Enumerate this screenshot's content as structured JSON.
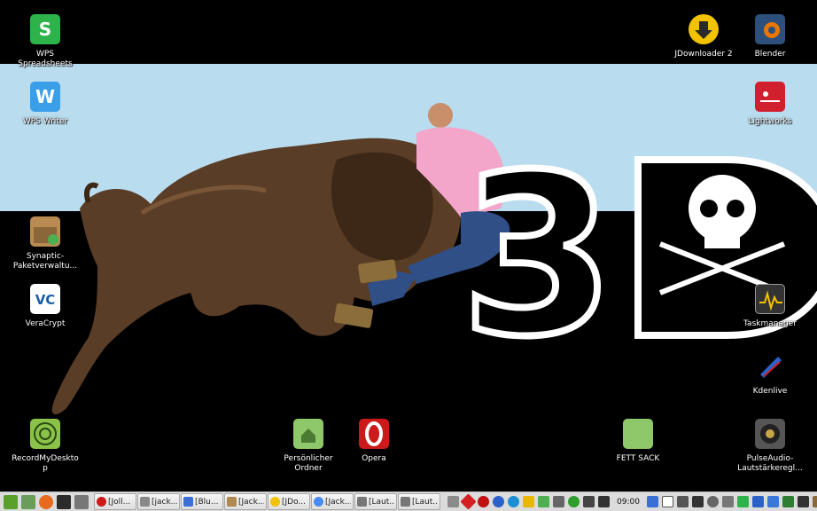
{
  "desktop": {
    "icons": [
      {
        "label": "WPS Spreadsheets",
        "icon": "wps-spreadsheets-icon",
        "color": "#2db34a"
      },
      {
        "label": "WPS Writer",
        "icon": "wps-writer-icon",
        "color": "#3a9ee8"
      },
      {
        "label": "Synaptic-Paketverwaltu...",
        "icon": "synaptic-package-icon",
        "color": "#b98b52"
      },
      {
        "label": "VeraCrypt",
        "icon": "veracrypt-icon",
        "color": "#ffffff"
      },
      {
        "label": "RecordMyDesktop",
        "icon": "recordmydesktop-icon",
        "color": "#8bc34a"
      },
      {
        "label": "Persönlicher Ordner",
        "icon": "home-folder-icon",
        "color": "#8fc86a"
      },
      {
        "label": "Opera",
        "icon": "opera-icon",
        "color": "#cc1a1a"
      },
      {
        "label": "FETT SACK",
        "icon": "folder-icon",
        "color": "#8fc86a"
      },
      {
        "label": "JDownloader 2",
        "icon": "jdownloader-icon",
        "color": "#f2c200"
      },
      {
        "label": "Blender",
        "icon": "blender-icon",
        "color": "#ea7600"
      },
      {
        "label": "Lightworks",
        "icon": "lightworks-icon",
        "color": "#d0202e"
      },
      {
        "label": "Taskmanager",
        "icon": "taskmanager-icon",
        "color": "#333333"
      },
      {
        "label": "Kdenlive",
        "icon": "kdenlive-icon",
        "color": "#2a62c9"
      },
      {
        "label": "PulseAudio-Lautstärkeregl...",
        "icon": "pulseaudio-icon",
        "color": "#555555"
      }
    ],
    "wallpaper": {
      "logo_text": "3D"
    }
  },
  "taskbar": {
    "launchers": [
      {
        "icon": "mint-menu-icon",
        "color": "#5aa02c"
      },
      {
        "icon": "show-desktop-icon",
        "color": "#6a9c5a"
      },
      {
        "icon": "firefox-icon",
        "color": "#e86a1c"
      },
      {
        "icon": "terminal-icon",
        "color": "#2b2b2b"
      },
      {
        "icon": "files-icon",
        "color": "#777777"
      }
    ],
    "windows": [
      {
        "label": "[Joll...",
        "icon": "opera-icon",
        "color": "#cc1a1a"
      },
      {
        "label": "[jack...",
        "icon": "files-icon",
        "color": "#888888"
      },
      {
        "label": "[Blu...",
        "icon": "bluetooth-icon",
        "color": "#3b6fd6"
      },
      {
        "label": "[Jack...",
        "icon": "image-viewer-icon",
        "color": "#b0894f"
      },
      {
        "label": "[JDo...",
        "icon": "jdownloader-icon",
        "color": "#f2c200"
      },
      {
        "label": "[Jack...",
        "icon": "chrome-icon",
        "color": "#4a8af4"
      },
      {
        "label": "[Laut...",
        "icon": "volume-icon",
        "color": "#777777"
      },
      {
        "label": "[Laut...",
        "icon": "volume-icon",
        "color": "#777777"
      }
    ],
    "tray": [
      {
        "icon": "network-icon",
        "color": "#8b8b8b"
      },
      {
        "icon": "redshift-icon",
        "color": "#d42020"
      },
      {
        "icon": "red-diamond-icon",
        "color": "#c01010"
      },
      {
        "icon": "bluetooth-tray-icon",
        "color": "#2a62c9"
      },
      {
        "icon": "bluetooth-tray-icon-2",
        "color": "#1a8fd6"
      },
      {
        "icon": "jdownloader-tray-icon",
        "color": "#e8b800"
      },
      {
        "icon": "update-shield-icon",
        "color": "#4caf50"
      },
      {
        "icon": "signal-icon",
        "color": "#666666"
      },
      {
        "icon": "checkmark-icon",
        "color": "#2e9e2e"
      },
      {
        "icon": "sync-icon",
        "color": "#444444"
      },
      {
        "icon": "speaker-icon",
        "color": "#333333"
      }
    ],
    "clock": "09:00",
    "tray_right": [
      {
        "icon": "notes-icon",
        "color": "#3b6fd6"
      },
      {
        "icon": "calendar-icon",
        "color": "#ffffff"
      },
      {
        "icon": "calculator-icon",
        "color": "#555555"
      },
      {
        "icon": "monitor-icon",
        "color": "#333333"
      },
      {
        "icon": "settings-icon",
        "color": "#666666"
      },
      {
        "icon": "disk-icon",
        "color": "#777777"
      },
      {
        "icon": "wps-tray-icon",
        "color": "#2db34a"
      },
      {
        "icon": "kde-connect-icon",
        "color": "#2a62c9"
      },
      {
        "icon": "avidemux-icon",
        "color": "#3c78d8"
      },
      {
        "icon": "monitor-green-icon",
        "color": "#2e7d32"
      },
      {
        "icon": "media-player-icon",
        "color": "#333333"
      },
      {
        "icon": "archive-icon",
        "color": "#8a6a3a"
      }
    ]
  }
}
